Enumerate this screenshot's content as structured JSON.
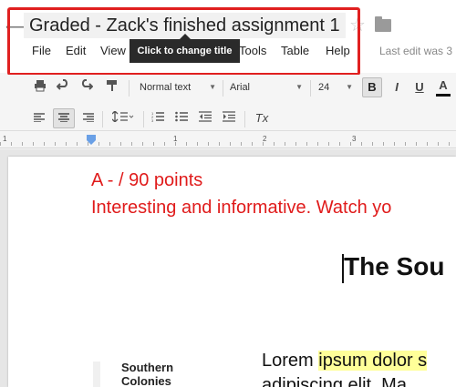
{
  "header": {
    "back_glyph": "⟵",
    "title": "Graded - Zack's finished assignment 1",
    "star_glyph": "☆",
    "last_edit": "Last edit was 3"
  },
  "menu": {
    "file": "File",
    "edit": "Edit",
    "view": "View",
    "tools": "Tools",
    "table": "Table",
    "help": "Help"
  },
  "tooltip": {
    "text": "Click to change title"
  },
  "toolbar": {
    "style": "Normal text",
    "font": "Arial",
    "size": "24",
    "bold": "B",
    "italic": "I",
    "underline": "U",
    "text_color": "A",
    "clear_format": "Tx"
  },
  "ruler": {
    "n1": "1",
    "n2": "1",
    "n3": "2",
    "n4": "3"
  },
  "document": {
    "grade": "A - / 90 points",
    "comment": "Interesting and informative. Watch yo",
    "heading": "The Sou",
    "body_start": "Lorem ",
    "body_highlight": "ipsum dolor s",
    "body_line2": "adipiscing elit. Ma",
    "side_label_1": "Southern",
    "side_label_2": "Colonies"
  },
  "colors": {
    "annotation_red": "#e01b1b",
    "highlight_box": "#e02020",
    "text_highlight": "#ffff99"
  },
  "icons": [
    "back-arrow-icon",
    "star-icon",
    "folder-icon",
    "print-icon",
    "undo-icon",
    "redo-icon",
    "paint-format-icon",
    "bold-icon",
    "italic-icon",
    "underline-icon",
    "text-color-icon",
    "align-left-icon",
    "align-center-icon",
    "align-right-icon",
    "line-spacing-icon",
    "numbered-list-icon",
    "bulleted-list-icon",
    "decrease-indent-icon",
    "increase-indent-icon",
    "clear-formatting-icon"
  ]
}
